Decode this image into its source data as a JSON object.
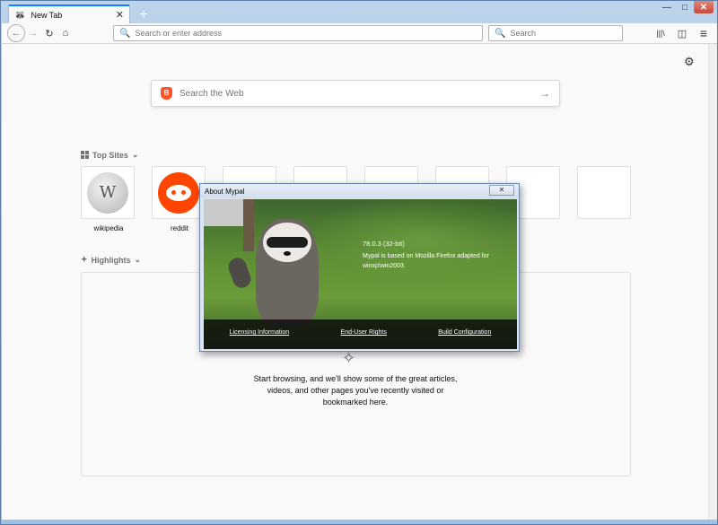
{
  "window": {
    "controls": {
      "minimize": "—",
      "maximize": "□",
      "close": "✕"
    }
  },
  "tab": {
    "title": "New Tab",
    "close": "✕"
  },
  "toolbar": {
    "new_tab": "+",
    "back": "←",
    "forward": "→",
    "reload": "↻",
    "home": "⌂",
    "library": "|||\\",
    "sidebar": "◫",
    "menu": "≡"
  },
  "urlbar": {
    "placeholder": "Search or enter address"
  },
  "searchbar": {
    "placeholder": "Search"
  },
  "newtab_page": {
    "settings_icon": "⚙",
    "web_search_placeholder": "Search the Web",
    "web_search_arrow": "→",
    "top_sites": {
      "title": "Top Sites",
      "chevron": "⌄",
      "sites": [
        {
          "label": "wikipedia",
          "icon": "wikipedia-icon"
        },
        {
          "label": "reddit",
          "icon": "reddit-icon"
        },
        {
          "label": ""
        },
        {
          "label": ""
        },
        {
          "label": ""
        },
        {
          "label": ""
        },
        {
          "label": ""
        },
        {
          "label": ""
        }
      ]
    },
    "highlights": {
      "title": "Highlights",
      "chevron": "⌄",
      "empty_message": "Start browsing, and we'll show some of the great articles, videos, and other pages you've recently visited or bookmarked here."
    }
  },
  "about_dialog": {
    "title": "About Mypal",
    "close": "✕",
    "version": "78.0.3 (32-bit)",
    "description": "Mypal is based on Mozilla Firefox adapted for winxp\\win2003.",
    "links": [
      "Licensing Information",
      "End-User Rights",
      "Build Configuration"
    ]
  }
}
